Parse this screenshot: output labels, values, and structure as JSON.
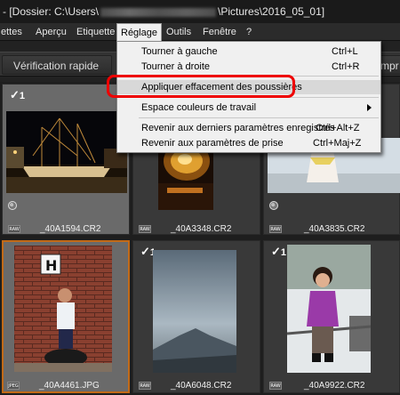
{
  "window": {
    "title_prefix": "- [Dossier: C:\\Users\\",
    "title_suffix": "\\Pictures\\2016_05_01]"
  },
  "menubar": [
    "ettes",
    "Aperçu",
    "Etiquette",
    "Réglage",
    "Outils",
    "Fenêtre",
    "?"
  ],
  "toolbar": {
    "quick_check": "Vérification rapide",
    "print_partial": "mpr"
  },
  "menu": {
    "items": [
      {
        "label": "Tourner à gauche",
        "shortcut": "Ctrl+L"
      },
      {
        "label": "Tourner à droite",
        "shortcut": "Ctrl+R"
      },
      {
        "label": "Appliquer effacement des poussières",
        "shortcut": ""
      },
      {
        "label": "Espace couleurs de travail",
        "shortcut": ""
      },
      {
        "label": "Revenir aux derniers paramètres enregistrés",
        "shortcut": "Ctrl+Alt+Z"
      },
      {
        "label": "Revenir aux paramètres de prise",
        "shortcut": "Ctrl+Maj+Z"
      }
    ]
  },
  "thumbnails": [
    {
      "filename": "_40A1594.CR2",
      "format": "RAW",
      "rating": "1"
    },
    {
      "filename": "_40A3348.CR2",
      "format": "RAW",
      "rating": ""
    },
    {
      "filename": "_40A3835.CR2",
      "format": "RAW",
      "rating": ""
    },
    {
      "filename": "_40A4461.JPG",
      "format": "JPEG",
      "rating": ""
    },
    {
      "filename": "_40A6048.CR2",
      "format": "RAW",
      "rating": "1"
    },
    {
      "filename": "_40A9922.CR2",
      "format": "RAW",
      "rating": "1"
    }
  ],
  "colors": {
    "highlight_ring": "#e00000",
    "selection_border": "#c26a17",
    "menu_bg": "#f0f0f0"
  }
}
